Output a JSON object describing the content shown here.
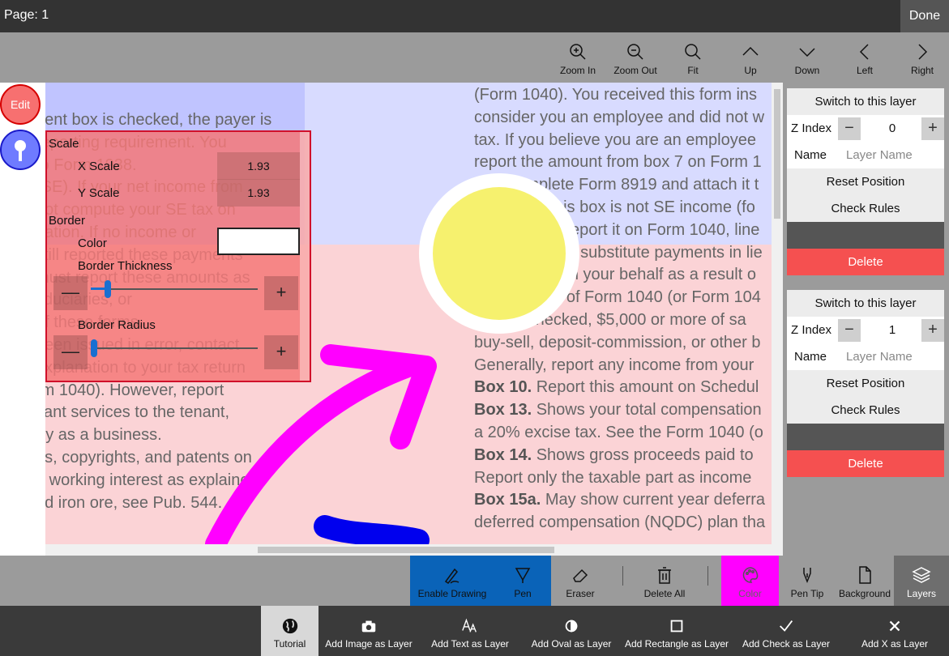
{
  "header": {
    "page_label": "Page: 1",
    "done_label": "Done"
  },
  "nav": [
    {
      "label": "Zoom In",
      "icon": "zoom-in-icon"
    },
    {
      "label": "Zoom Out",
      "icon": "zoom-out-icon"
    },
    {
      "label": "Fit",
      "icon": "search-icon"
    },
    {
      "label": "Up",
      "icon": "chevron-up-icon"
    },
    {
      "label": "Down",
      "icon": "chevron-down-icon"
    },
    {
      "label": "Left",
      "icon": "chevron-left-icon"
    },
    {
      "label": "Right",
      "icon": "chevron-right-icon"
    }
  ],
  "left_buttons": {
    "edit_label": "Edit",
    "pin_icon": "pin-icon"
  },
  "document": {
    "left_lines": [
      "nent box is checked, the payer is",
      "reporting requirement. You",
      "to Form 1938.",
      "(SE). If your net income from",
      "not compute your SE tax on",
      "nation. If no income or",
      "still reported these payments",
      "must report these amounts as",
      "fiduciaries, or",
      "of these forms.",
      "been issued in error, contact",
      "explanation to your tax return",
      "rm 1040). However, report",
      "cant services to the tenant,",
      "rty as a business.",
      "es, copyrights, and patents on",
      "a working interest as explained",
      "nd iron ore, see Pub. 544."
    ],
    "right_lines": [
      {
        "bold": "",
        "text": "(Form 1040). You received this form ins"
      },
      {
        "bold": "",
        "text": "consider you an employee and did not w"
      },
      {
        "bold": "",
        "text": "tax. If you believe you are an employee"
      },
      {
        "bold": "",
        "text": "report the amount from box 7 on Form 1"
      },
      {
        "bold": "",
        "text": "also complete Form 8919 and attach it t"
      },
      {
        "bold": "",
        "text": "amount in this box is not SE income (fo"
      },
      {
        "bold": "",
        "text": "or a hobby), report it on Form 1040, line"
      },
      {
        "bold": "Box 8.",
        "text": " Shows substitute payments in lie"
      },
      {
        "bold": "",
        "text": "your broker on your behalf as a result o"
      },
      {
        "bold": "",
        "text": "income\" line of Form 1040 (or Form 104"
      },
      {
        "bold": "Box 9.",
        "text": " checked, $5,000 or more of sa"
      },
      {
        "bold": "",
        "text": "buy-sell, deposit-commission, or other b"
      },
      {
        "bold": "",
        "text": "Generally, report any income from your"
      },
      {
        "bold": "Box 10.",
        "text": " Report this amount on Schedul"
      },
      {
        "bold": "Box 13.",
        "text": " Shows your total compensation"
      },
      {
        "bold": "",
        "text": "a 20% excise tax. See the Form 1040 (o"
      },
      {
        "bold": "Box 14.",
        "text": " Shows gross proceeds paid to"
      },
      {
        "bold": "",
        "text": "Report only the taxable part as income"
      },
      {
        "bold": "Box 15a.",
        "text": " May show current year deferra"
      },
      {
        "bold": "",
        "text": "deferred compensation (NQDC) plan tha"
      }
    ]
  },
  "scale_panel": {
    "scale_label": "Scale",
    "x_scale_label": "X Scale",
    "x_scale_value": "1.93",
    "y_scale_label": "Y Scale",
    "y_scale_value": "1.93",
    "border_label": "Border",
    "color_label": "Color",
    "border_thickness_label": "Border Thickness",
    "border_thickness_level": 0.1,
    "border_radius_label": "Border Radius",
    "border_radius_level": 0.02,
    "minus": "—",
    "plus": "+"
  },
  "layers": [
    {
      "switch_label": "Switch to this layer",
      "zindex_label": "Z Index",
      "zindex_value": "0",
      "name_label": "Name",
      "name_placeholder": "Layer Name",
      "reset_label": "Reset Position",
      "check_label": "Check Rules",
      "delete_label": "Delete"
    },
    {
      "switch_label": "Switch to this layer",
      "zindex_label": "Z Index",
      "zindex_value": "1",
      "name_label": "Name",
      "name_placeholder": "Layer Name",
      "reset_label": "Reset Position",
      "check_label": "Check Rules",
      "delete_label": "Delete"
    }
  ],
  "toolbar1": [
    {
      "label": "Enable Drawing",
      "icon": "pen-scribble-icon"
    },
    {
      "label": "Pen",
      "icon": "pen-icon"
    },
    {
      "label": "Eraser",
      "icon": "eraser-icon"
    },
    {
      "label": "Delete All",
      "icon": "trash-icon"
    },
    {
      "label": "Color",
      "icon": "palette-icon"
    },
    {
      "label": "Pen Tip",
      "icon": "pen-tip-icon"
    },
    {
      "label": "Background",
      "icon": "page-icon"
    },
    {
      "label": "Layers",
      "icon": "layers-icon"
    }
  ],
  "toolbar2": [
    {
      "label": "Tutorial",
      "icon": "globe-icon"
    },
    {
      "label": "Add Image as Layer",
      "icon": "camera-icon"
    },
    {
      "label": "Add Text as Layer",
      "icon": "text-icon"
    },
    {
      "label": "Add Oval as Layer",
      "icon": "oval-icon"
    },
    {
      "label": "Add Rectangle as Layer",
      "icon": "rectangle-icon"
    },
    {
      "label": "Add Check as Layer",
      "icon": "check-icon"
    },
    {
      "label": "Add X as Layer",
      "icon": "x-icon"
    }
  ],
  "colors": {
    "accent_blue": "#0a63b8",
    "pen_magenta": "#ff00ff",
    "delete_red": "#f55050",
    "highlight_yellow": "#f5ee55",
    "ink_blue": "#0000ee"
  }
}
